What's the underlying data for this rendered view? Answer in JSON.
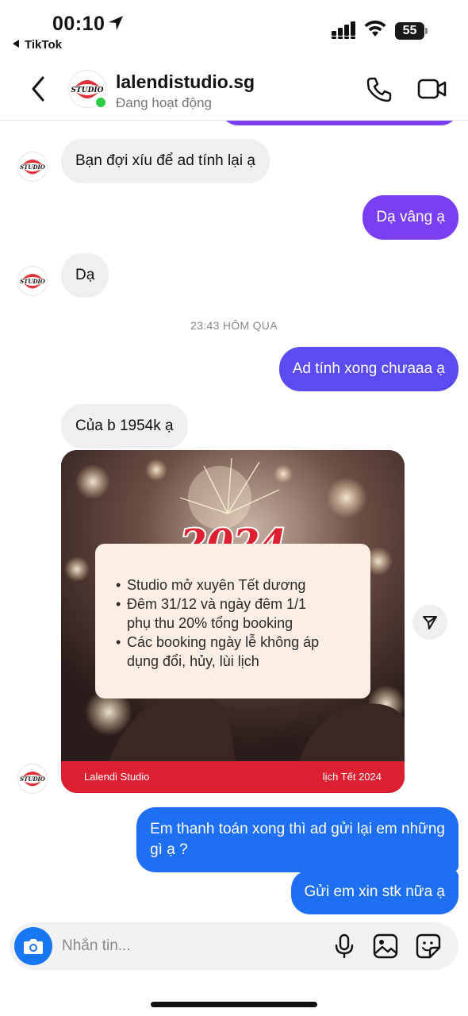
{
  "status_bar": {
    "time": "00:10",
    "back_app": "TikTok",
    "battery": "55",
    "icons": [
      "location-arrow-icon",
      "signal-icon",
      "wifi-icon",
      "battery-icon"
    ]
  },
  "header": {
    "contact_name": "lalendistudio.sg",
    "status": "Đang hoạt động",
    "avatar_logo_text": "STUDIO",
    "online": true,
    "icons": [
      "chevron-left-icon",
      "phone-icon",
      "video-icon"
    ]
  },
  "messages": [
    {
      "from": "them",
      "text": "Bạn đợi xíu để ad tính lại ạ"
    },
    {
      "from": "me",
      "text": "Dạ vâng ạ"
    },
    {
      "from": "them",
      "text": "Dạ"
    },
    {
      "timestamp": "23:43 HÔM QUA"
    },
    {
      "from": "me",
      "text": "Ad tính xong chưaaa ạ"
    },
    {
      "from": "them",
      "text": "Của b 1954k ạ"
    },
    {
      "from": "them",
      "type": "image_post"
    },
    {
      "from": "me",
      "text": "Em thanh toán xong thì ad gửi lại em những\ngì ạ ?"
    },
    {
      "from": "me",
      "text": "Gửi em xin stk nữa ạ"
    }
  ],
  "post": {
    "year": "2024",
    "items": [
      "Studio mở xuyên Tết dương",
      "Đêm 31/12 và ngày đêm 1/1 phụ thu 20% tổng booking",
      "Các booking ngày lễ không áp dụng đổi, hủy, lùi lịch"
    ],
    "item_lines": [
      [
        "Studio mở xuyên Tết dương"
      ],
      [
        "Đêm 31/12 và ngày đêm 1/1",
        "phụ thu 20% tổng booking"
      ],
      [
        "Các booking ngày lễ không áp",
        "dụng đổi, hủy, lùi lịch"
      ]
    ],
    "footer_left": "Lalendi Studio",
    "footer_right": "lịch Tết 2024"
  },
  "composer": {
    "placeholder": "Nhắn tin...",
    "icons": [
      "camera-icon",
      "microphone-icon",
      "gallery-icon",
      "sticker-icon"
    ]
  },
  "colors": {
    "outgoing_purple": "#7a3ff2",
    "outgoing_indigo": "#5b4bf0",
    "outgoing_blue": "#1f6ff2",
    "incoming_gray": "#efefef",
    "online_green": "#2ecc48",
    "brand_red": "#dc2032"
  }
}
